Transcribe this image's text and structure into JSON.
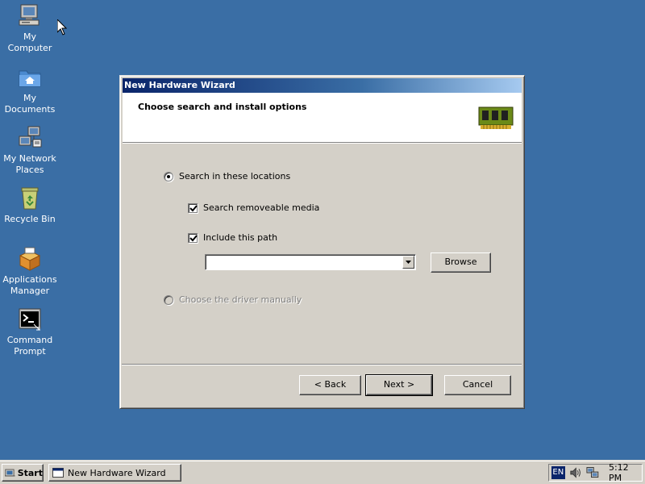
{
  "desktop": {
    "icons": [
      {
        "label": "My\nComputer",
        "icon": "my-computer-icon"
      },
      {
        "label": "My\nDocuments",
        "icon": "my-documents-icon"
      },
      {
        "label": "My Network\nPlaces",
        "icon": "network-places-icon"
      },
      {
        "label": "Recycle Bin",
        "icon": "recycle-bin-icon"
      },
      {
        "label": "Applications\nManager",
        "icon": "applications-manager-icon"
      },
      {
        "label": "Command\nPrompt",
        "icon": "command-prompt-icon"
      }
    ]
  },
  "wizard": {
    "title": "New Hardware Wizard",
    "header": "Choose search and install options",
    "header_icon": "hardware-card-icon",
    "options": {
      "search_locations": {
        "label": "Search in these locations",
        "selected": true
      },
      "removable_media": {
        "label": "Search removeable media",
        "checked": true
      },
      "include_path": {
        "label": "Include this path",
        "checked": true
      },
      "path_value": "",
      "choose_manually": {
        "label": "Choose the driver manually",
        "enabled": false
      }
    },
    "browse_label": "Browse",
    "buttons": {
      "back": "< Back",
      "next": "Next >",
      "cancel": "Cancel"
    }
  },
  "taskbar": {
    "start_label": "Start",
    "task_label": "New Hardware Wizard",
    "tray": {
      "language": "EN",
      "icons": [
        "volume-icon",
        "network-icon"
      ],
      "clock": "5:12 PM"
    }
  },
  "colors": {
    "desktop_bg": "#3a6ea5",
    "dialog_face": "#d4d0c8",
    "title_active": "#0a246a"
  }
}
